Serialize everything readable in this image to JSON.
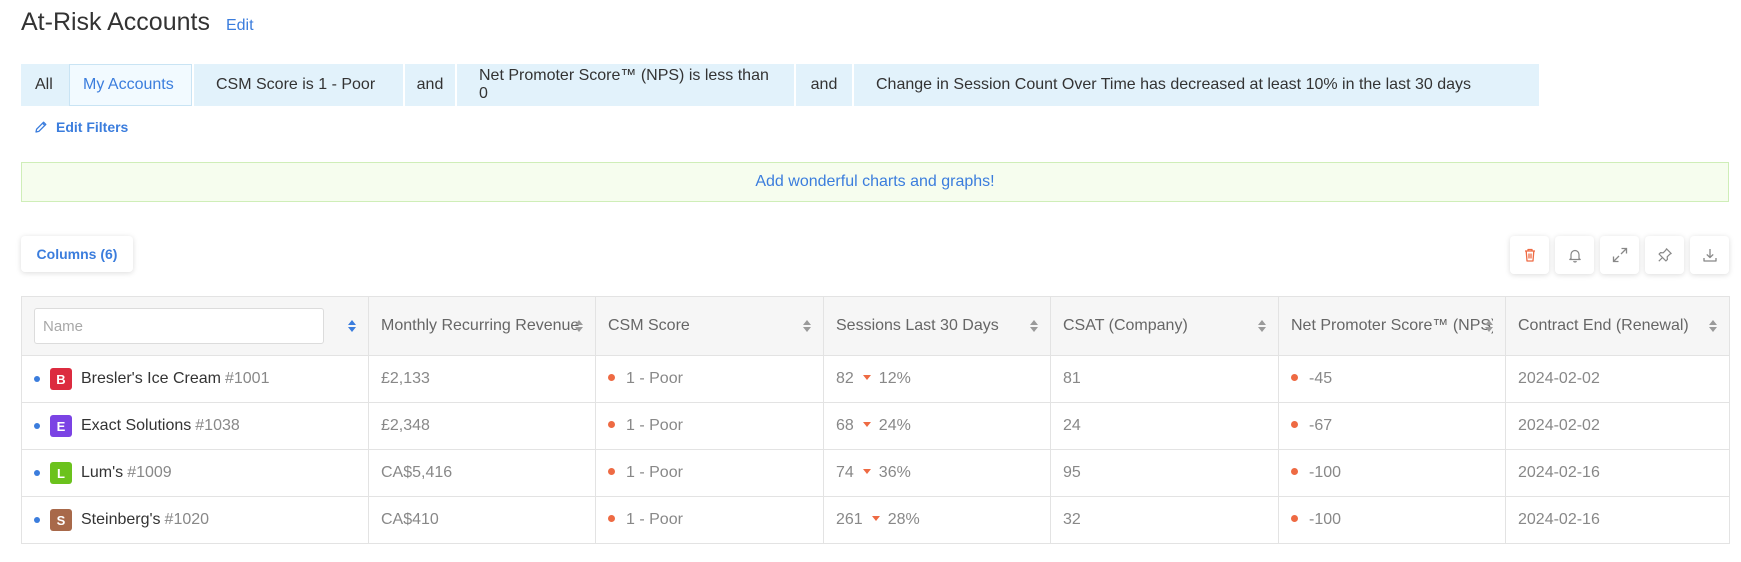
{
  "header": {
    "title": "At-Risk Accounts",
    "edit_label": "Edit"
  },
  "filters": {
    "scope_all": "All",
    "scope_mine": "My Accounts",
    "conditions": [
      "CSM Score is 1 - Poor",
      "Net Promoter Score™ (NPS) is less than 0",
      "Change in Session Count Over Time has decreased at least 10% in the last 30 days"
    ],
    "joiner": "and",
    "edit_filters_label": "Edit Filters"
  },
  "banner": {
    "text": "Add wonderful charts and graphs!"
  },
  "toolbar": {
    "columns_label": "Columns (6)",
    "icons": [
      "trash-icon",
      "bell-icon",
      "expand-icon",
      "pin-icon",
      "download-icon"
    ]
  },
  "table": {
    "name_placeholder": "Name",
    "columns": [
      "Monthly Recurring Revenue",
      "CSM Score",
      "Sessions Last 30 Days",
      "CSAT (Company)",
      "Net Promoter Score™ (NPS)",
      "Contract End (Renewal)"
    ],
    "rows": [
      {
        "initial": "B",
        "avatar_color": "#dc2b3f",
        "name": "Bresler's Ice Cream",
        "id": "#1001",
        "mrr": "£2,133",
        "csm": "1 - Poor",
        "sessions": "82",
        "session_change": "12%",
        "csat": "81",
        "nps": "-45",
        "contract_end": "2024-02-02"
      },
      {
        "initial": "E",
        "avatar_color": "#7b43e4",
        "name": "Exact Solutions",
        "id": "#1038",
        "mrr": "£2,348",
        "csm": "1 - Poor",
        "sessions": "68",
        "session_change": "24%",
        "csat": "24",
        "nps": "-67",
        "contract_end": "2024-02-02"
      },
      {
        "initial": "L",
        "avatar_color": "#6bc21d",
        "name": "Lum's",
        "id": "#1009",
        "mrr": "CA$5,416",
        "csm": "1 - Poor",
        "sessions": "74",
        "session_change": "36%",
        "csat": "95",
        "nps": "-100",
        "contract_end": "2024-02-16"
      },
      {
        "initial": "S",
        "avatar_color": "#a8694a",
        "name": "Steinberg's",
        "id": "#1020",
        "mrr": "CA$410",
        "csm": "1 - Poor",
        "sessions": "261",
        "session_change": "28%",
        "csat": "32",
        "nps": "-100",
        "contract_end": "2024-02-16"
      }
    ]
  },
  "colors": {
    "accent": "#3b7ddd",
    "danger": "#ee6a43",
    "filter_bg": "#e2f2fb",
    "banner_bg": "#f6fdee"
  }
}
